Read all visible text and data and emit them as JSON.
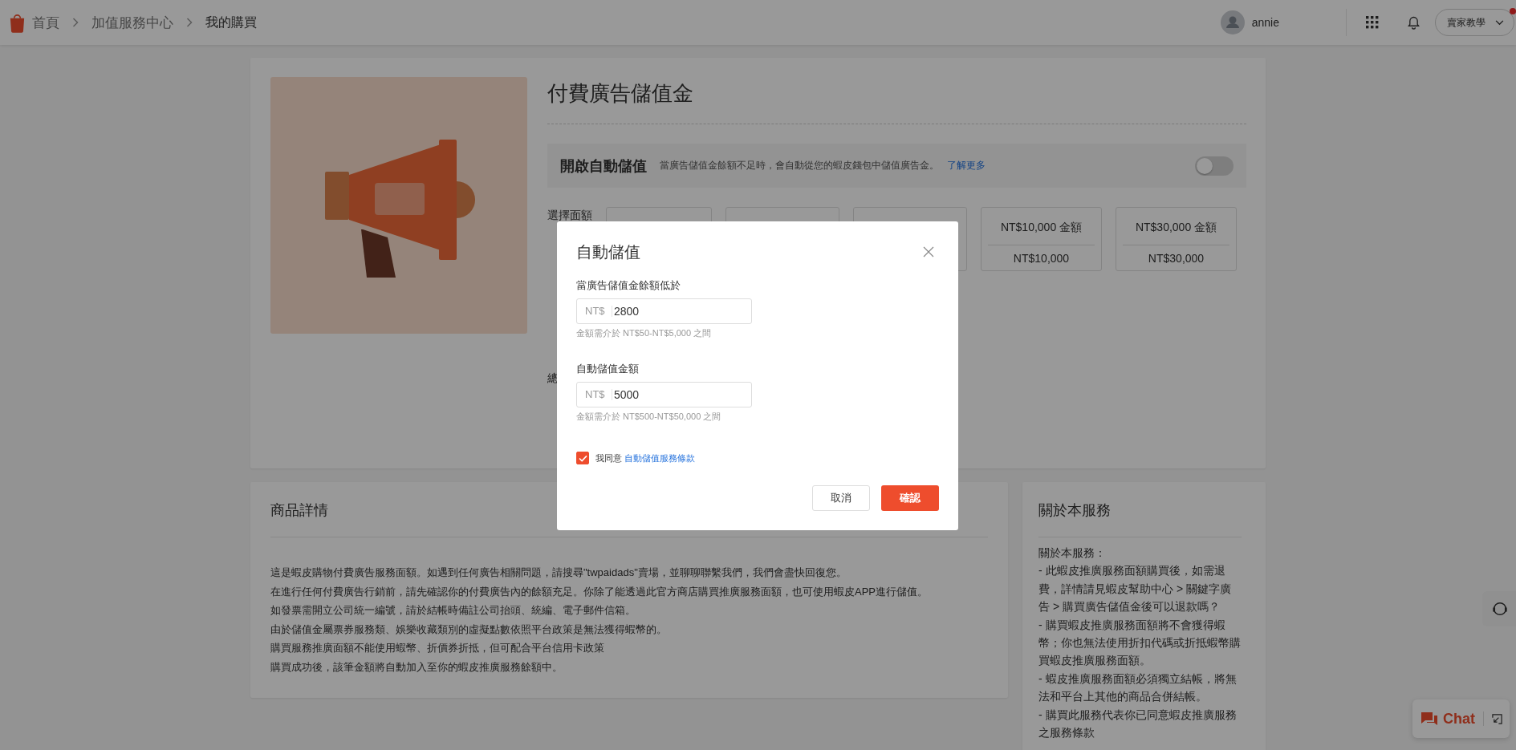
{
  "breadcrumb": [
    {
      "label": "首頁",
      "current": false
    },
    {
      "label": "加值服務中心",
      "current": false
    },
    {
      "label": "我的購買",
      "current": true
    }
  ],
  "user": {
    "name": "annie"
  },
  "seller_guide": {
    "label": "賣家教學",
    "has_notification": true
  },
  "product": {
    "title": "付費廣告儲值金"
  },
  "auto_topup": {
    "title": "開啟自動儲值",
    "description": "當廣告儲值金餘額不足時，會自動從您的蝦皮錢包中儲值廣告金。",
    "link": "了解更多",
    "on": false
  },
  "amount_label": "選擇面額",
  "amount_options": [
    {
      "kind": "covered"
    },
    {
      "kind": "covered"
    },
    {
      "kind": "covered"
    },
    {
      "kind": "amount",
      "label": "NT$10,000 金額",
      "price": "NT$10,000"
    },
    {
      "kind": "amount",
      "label": "NT$30,000 金額",
      "price": "NT$30,000"
    }
  ],
  "total_label": "總",
  "details": {
    "title": "商品詳情",
    "lines": [
      "這是蝦皮購物付費廣告服務面額。如遇到任何廣告相關問題，請搜尋\"twpaidads\"賣場，並聊聊聯繫我們，我們會盡快回復您。",
      "在進行任何付費廣告行銷前，請先確認你的付費廣告內的餘額充足。你除了能透過此官方商店購買推廣服務面額，也可使用蝦皮APP進行儲值。",
      "如發票需開立公司統一編號，請於結帳時備註公司抬頭、統編、電子郵件信箱。",
      "由於儲值金屬票券服務類、娛樂收藏類別的虛擬點數依照平台政策是無法獲得蝦幣的。",
      "購買服務推廣面額不能使用蝦幣、折價券折抵，但可配合平台信用卡政策",
      "購買成功後，該筆金額將自動加入至你的蝦皮推廣服務餘額中。"
    ]
  },
  "about": {
    "title": "關於本服務",
    "lines": [
      "關於本服務：",
      "- 此蝦皮推廣服務面額購買後，如需退費，詳情請見蝦皮幫助中心 > 關鍵字廣告 > 購買廣告儲值金後可以退款嗎？",
      "- 購買蝦皮推廣服務面額將不會獲得蝦幣；你也無法使用折扣代碼或折抵蝦幣購買蝦皮推廣服務面額。",
      "- 蝦皮推廣服務面額必須獨立結帳，將無法和平台上其他的商品合併結帳。",
      "- 購買此服務代表你已同意蝦皮推廣服務之服務條款"
    ]
  },
  "dialog": {
    "title": "自動儲值",
    "fields": [
      {
        "label": "當廣告儲值金餘額低於",
        "prefix": "NT$",
        "value": "2800",
        "hint": "金額需介於 NT$50-NT$5,000 之間"
      },
      {
        "label": "自動儲值金額",
        "prefix": "NT$",
        "value": "5000",
        "hint": "金額需介於 NT$500-NT$50,000 之間"
      }
    ],
    "agreement": {
      "text": "我同意",
      "link": "自動儲值服務條款",
      "checked": true
    },
    "buttons": [
      {
        "label": "取消",
        "kind": "secondary"
      },
      {
        "label": "確認",
        "kind": "primary"
      }
    ]
  },
  "chat": {
    "label": "Chat"
  }
}
